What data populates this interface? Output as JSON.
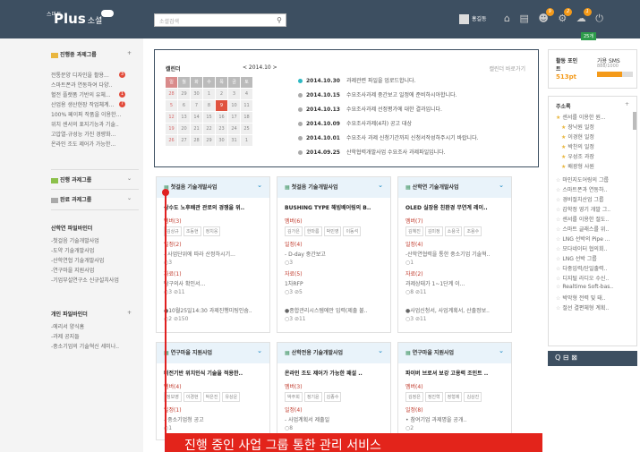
{
  "header": {
    "logo_small": "스마트",
    "logo": "Plus",
    "logo_sub": "소셜",
    "search_placeholder": "소셜검색",
    "user_name": "홍길동",
    "badge1": "9",
    "badge2": "2",
    "badge3": "1",
    "badge_green": "25개"
  },
  "left": {
    "sec1_title": "진행중 과제그룹",
    "plus": "+",
    "sec1_items": [
      "전통문양 디자인을 활용...",
      "스마트폰과 연동하여 다양..",
      "혈전 플랫폼 기반의 유체...",
      "산업용 생산현장 작업체계...",
      "100% 페이퍼 작품을 이용한...",
      "위치 센서의 표지기능과 기술..",
      "고압열-규성능 가진 경량화...",
      "온라인 조도 제어가 가능한..."
    ],
    "sec1_badges": [
      "3",
      "",
      "1",
      "7",
      "",
      "",
      "",
      ""
    ],
    "sec2_title": "진행 과제그룹",
    "sec3_title": "완료 과제그룹",
    "sec4_title": "산학연 파일바인더",
    "sec4_items": [
      "-첫걸음 기술개발사업",
      "-도약 기술개발사업",
      "-산학연협 기술개발사업",
      "-연구마을 지원사업",
      "-기업부설연구소 신규설치사업"
    ],
    "sec5_title": "개인 파일바인더",
    "sec5_items": [
      "-에리서 양식홈",
      "-과제 공지들",
      "-중소기업의 기술혁신 세미나.."
    ]
  },
  "calendar": {
    "title": "캘린더",
    "month": "< 2014.10 >",
    "link": "캘린더 바로가기",
    "head": [
      "일",
      "월",
      "화",
      "수",
      "목",
      "금",
      "토"
    ],
    "rows": [
      [
        "28",
        "29",
        "30",
        "1",
        "2",
        "3",
        "4"
      ],
      [
        "5",
        "6",
        "7",
        "8",
        "9",
        "10",
        "11"
      ],
      [
        "12",
        "13",
        "14",
        "15",
        "16",
        "17",
        "18"
      ],
      [
        "19",
        "20",
        "21",
        "22",
        "23",
        "24",
        "25"
      ],
      [
        "26",
        "27",
        "28",
        "29",
        "30",
        "31",
        "1"
      ]
    ],
    "events": [
      {
        "date": "2014.10.30",
        "text": "과제관련 파일을 업로드합니다."
      },
      {
        "date": "2014.10.15",
        "text": "수요조사과제 중간보고 일정에 준비하시아합니다."
      },
      {
        "date": "2014.10.13",
        "text": "수요조사과제 선정평가에 대한 결과입니다."
      },
      {
        "date": "2014.10.09",
        "text": "수요조사과제(4차) 공고 대상"
      },
      {
        "date": "2014.10.01",
        "text": "수요조사 과제 신청기간까지 신청서작성하주시기 바랍니다."
      },
      {
        "date": "2014.09.25",
        "text": "산학협력개발사업 수요조사 과제파일입니다."
      }
    ]
  },
  "cards": [
    {
      "head": "첫걸음 기술개발사업",
      "title": "상수도 노후배관 관로의 경쟁을 위..",
      "m_label": "멤버(3)",
      "tags": [
        "김상규",
        "조동현",
        "정치웅"
      ],
      "s_label": "일정(2)",
      "s_line": "- 사업단위에 따라 산정하시기...",
      "s_stat": "○3",
      "d_label": "자료(1)",
      "d_line": "탐구의사 확인서...",
      "d_stat": "○3  ⊘11",
      "foot": "●10월25일14:30 과제진행미팅인숨..",
      "foot2": "○2  ⊘150"
    },
    {
      "head": "첫걸음 기술개발사업",
      "title": "BUSHING TYPE 해빙배어링의 B..",
      "m_label": "멤버(6)",
      "tags": [
        "김가은",
        "한마름",
        "박민영",
        "이동석"
      ],
      "s_label": "일정(4)",
      "s_line": "- D-day 중간보고",
      "s_stat": "○3",
      "d_label": "자료(5)",
      "d_line": "1차RFP",
      "d_stat": "○3  ⊘5",
      "foot": "●종합관리시스템에만 입력(제출 불..",
      "foot2": "○3  ⊘11"
    },
    {
      "head": "산학연 기술개발사업",
      "title": "OLED 실장용 친환경 무연계 레이..",
      "m_label": "멤버(7)",
      "tags": [
        "김혜진",
        "김미정",
        "소용국",
        "조용수"
      ],
      "s_label": "일정(4)",
      "s_line": "-산학연협력을 통한 중소기업 기술혁..",
      "s_stat": "○1",
      "d_label": "자료(2)",
      "d_line": "과제상태가 1~1단계 이...",
      "d_stat": "○8  ⊘11",
      "foot": "●사업신청서, 사업계획서, 산출정보..",
      "foot2": "○3  ⊘11"
    },
    {
      "head": "연구마을 지원사업",
      "title": "비전기반 위치인식 기술을 적용한..",
      "m_label": "멤버(4)",
      "tags": [
        "정보영",
        "이경현",
        "박은진",
        "유상운"
      ],
      "s_label": "일정(1)",
      "s_line": "- 중소기업청 공고",
      "s_stat": "○1",
      "d_label": "",
      "d_line": "",
      "d_stat": "",
      "foot": "",
      "foot2": ""
    },
    {
      "head": "산학전용 기술개발사업",
      "title": "온라인 조도 제어가 가능한 패설 ..",
      "m_label": "멤버(3)",
      "tags": [
        "박주희",
        "정기윤",
        "김종수"
      ],
      "s_label": "일정(4)",
      "s_line": "- 사업계획서 제출일",
      "s_stat": "○8",
      "d_label": "",
      "d_line": "",
      "d_stat": "",
      "foot": "",
      "foot2": ""
    },
    {
      "head": "연구마을 지원사업",
      "title": "파이버 브로셔 보강 고용력 조인트 ..",
      "m_label": "멤버(4)",
      "tags": [
        "김정은",
        "정진혁",
        "정형제",
        "김상진"
      ],
      "s_label": "일정(8)",
      "s_line": "• 참여기업 과제명을 공개..",
      "s_stat": "○2",
      "d_label": "",
      "d_line": "",
      "d_stat": "",
      "foot": "",
      "foot2": ""
    }
  ],
  "banner": "진행 중인 사업 그룹 통한 관리 서비스",
  "right": {
    "pt_label": "활동 포인트",
    "pt_value": "513pt",
    "sms_label": "가용 SMS",
    "sms_value": "888/1000",
    "sms_fill": 0.7,
    "fav_title": "주소록",
    "fav_items": [
      "센서를 이용한 원...",
      "장낙원 일정",
      "이경현 일정",
      "박찬의 일정",
      "우성조 과장",
      "배광형 사원"
    ],
    "list": [
      "마인지도어링의 그룹",
      "스마트폰과 연동하..",
      "경비절치산업 그룹",
      "감학정 영기 개발 그..",
      "센서를 이용한 절도..",
      "스마트 글래스를 위..",
      "LNG 선박의 Pipe ...",
      "모다네이터 협의회..",
      "LNG 선박 그룹",
      "다중입력/단일출력..",
      "디지털 라디오 수신..",
      "Realtime Soft-bas..",
      "박막형 전력 및 태..",
      "절선 결편체형 계획.."
    ],
    "foot_icons": "Q     ⊟ ⊠"
  }
}
